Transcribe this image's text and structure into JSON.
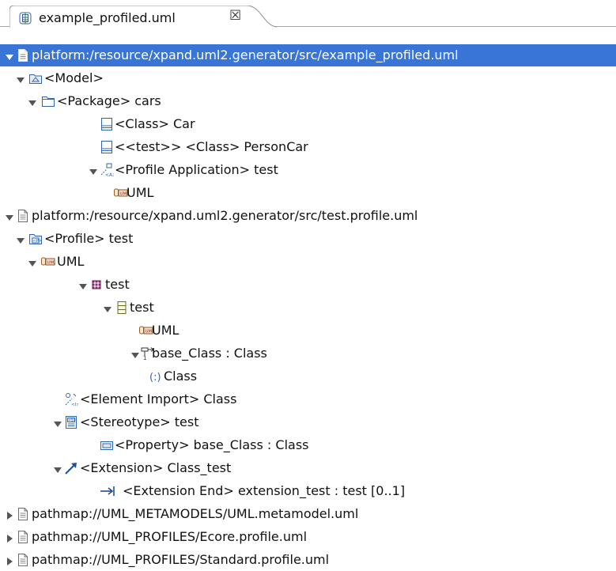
{
  "tab": {
    "title": "example_profiled.uml",
    "close_glyph": "☒"
  },
  "colors": {
    "selection": "#3875d7",
    "tree_line": "#a6a6a6"
  },
  "tree": [
    {
      "label": "platform:/resource/xpand.uml2.generator/src/example_profiled.uml",
      "icon": "file-icon",
      "expanded": true,
      "selected": true
    },
    {
      "label": "<Model>",
      "icon": "model-icon",
      "expanded": true
    },
    {
      "label": "<Package> cars",
      "icon": "package-icon",
      "expanded": true
    },
    {
      "label": "<Class> Car",
      "icon": "class-icon"
    },
    {
      "label": "<<test>> <Class> PersonCar",
      "icon": "class-icon"
    },
    {
      "label": "<Profile Application> test",
      "icon": "profile-application-icon",
      "expanded": true
    },
    {
      "label": "UML",
      "icon": "uml-reference-icon"
    },
    {
      "label": "platform:/resource/xpand.uml2.generator/src/test.profile.uml",
      "icon": "file-icon",
      "expanded": true
    },
    {
      "label": "<Profile> test",
      "icon": "profile-icon",
      "expanded": true
    },
    {
      "label": "UML",
      "icon": "uml-reference-icon",
      "expanded": true
    },
    {
      "label": "test",
      "icon": "ecore-package-icon",
      "expanded": true
    },
    {
      "label": "test",
      "icon": "eclass-icon",
      "expanded": true
    },
    {
      "label": "UML",
      "icon": "uml-reference-icon"
    },
    {
      "label": "base_Class : Class",
      "icon": "reference-icon",
      "expanded": true
    },
    {
      "label": "Class",
      "icon": "generic-type-icon"
    },
    {
      "label": "<Element Import> Class",
      "icon": "element-import-icon"
    },
    {
      "label": "<Stereotype> test",
      "icon": "stereotype-icon",
      "expanded": true
    },
    {
      "label": "<Property> base_Class : Class",
      "icon": "property-icon"
    },
    {
      "label": "<Extension> Class_test",
      "icon": "extension-icon",
      "expanded": true
    },
    {
      "label": "<Extension End> extension_test : test [0..1]",
      "icon": "extension-end-icon"
    },
    {
      "label": "pathmap://UML_METAMODELS/UML.metamodel.uml",
      "icon": "file-icon",
      "expanded": false
    },
    {
      "label": "pathmap://UML_PROFILES/Ecore.profile.uml",
      "icon": "file-icon",
      "expanded": false
    },
    {
      "label": "pathmap://UML_PROFILES/Standard.profile.uml",
      "icon": "file-icon",
      "expanded": false
    }
  ]
}
